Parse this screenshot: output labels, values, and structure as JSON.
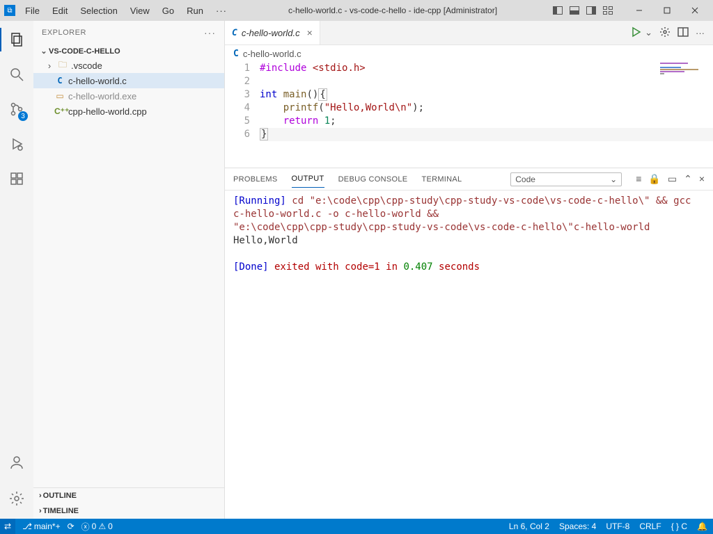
{
  "titlebar": {
    "menus": [
      "File",
      "Edit",
      "Selection",
      "View",
      "Go",
      "Run"
    ],
    "overflow": "···",
    "title": "c-hello-world.c - vs-code-c-hello - ide-cpp [Administrator]"
  },
  "activity": {
    "source_control_badge": "3"
  },
  "sidebar": {
    "title": "EXPLORER",
    "project": "VS-CODE-C-HELLO",
    "items": [
      {
        "kind": "folder",
        "label": ".vscode"
      },
      {
        "kind": "c",
        "label": "c-hello-world.c",
        "selected": true
      },
      {
        "kind": "exe",
        "label": "c-hello-world.exe",
        "dim": true
      },
      {
        "kind": "cpp",
        "label": "cpp-hello-world.cpp"
      }
    ],
    "sections": [
      "OUTLINE",
      "TIMELINE"
    ]
  },
  "editor": {
    "tab_label": "c-hello-world.c",
    "breadcrumb": "c-hello-world.c",
    "lines": [
      "1",
      "2",
      "3",
      "4",
      "5",
      "6"
    ],
    "code": {
      "l1_inc": "#include",
      "l1_hdr": "<stdio.h>",
      "l3_int": "int",
      "l3_main": "main",
      "l3_paren": "()",
      "l3_brace": "{",
      "l4_fn": "printf",
      "l4_open": "(",
      "l4_str": "\"Hello,World\\n\"",
      "l4_close": ");",
      "l5_ret": "return",
      "l5_num": "1",
      "l5_semi": ";",
      "l6_brace": "}"
    }
  },
  "panel": {
    "tabs": [
      "PROBLEMS",
      "OUTPUT",
      "DEBUG CONSOLE",
      "TERMINAL"
    ],
    "active_tab": "OUTPUT",
    "channel": "Code",
    "output": {
      "running_tag": "[Running]",
      "cmd_l1": " cd \"e:\\code\\cpp\\cpp-study\\cpp-study-vs-code\\vs-code-c-hello\\\" && gcc",
      "cmd_l2": "c-hello-world.c -o c-hello-world &&",
      "cmd_l3": "\"e:\\code\\cpp\\cpp-study\\cpp-study-vs-code\\vs-code-c-hello\\\"c-hello-world",
      "stdout": "Hello,World",
      "done_tag": "[Done]",
      "done_a": " exited with ",
      "done_code": "code=1",
      "done_b": " in ",
      "done_time": "0.407",
      "done_c": " seconds"
    }
  },
  "status": {
    "branch": "main*+",
    "errors": "0",
    "warnings": "0",
    "ln_col": "Ln 6, Col 2",
    "spaces": "Spaces: 4",
    "encoding": "UTF-8",
    "eol": "CRLF",
    "lang": "{ }  C"
  }
}
